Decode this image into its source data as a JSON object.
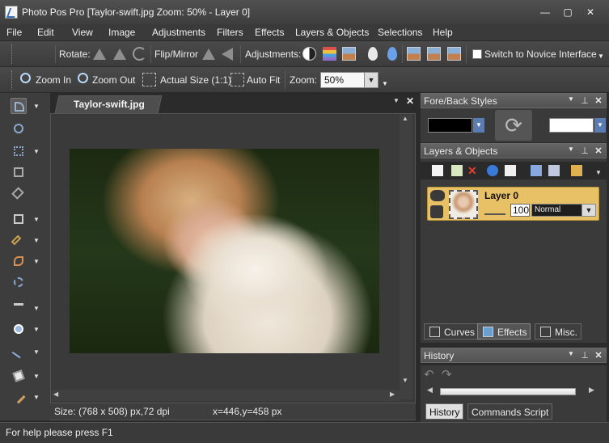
{
  "window": {
    "title": "Photo Pos Pro [Taylor-swift.jpg Zoom: 50% - Layer 0]",
    "minimize": "—",
    "restore": "▢",
    "close": "✕"
  },
  "menu": [
    "File",
    "Edit",
    "View",
    "Image",
    "Adjustments",
    "Filters",
    "Effects",
    "Layers & Objects",
    "Selections",
    "Help"
  ],
  "toolbar1": {
    "rotate_label": "Rotate:",
    "flip_label": "Flip/Mirror",
    "adjustments_label": "Adjustments:",
    "novice_label": "Switch to Novice Interface"
  },
  "toolbar2": {
    "zoom_in": "Zoom In",
    "zoom_out": "Zoom Out",
    "actual_size": "Actual Size (1:1)",
    "auto_fit": "Auto Fit",
    "zoom_label": "Zoom:",
    "zoom_value": "50%"
  },
  "document": {
    "tab_label": "Taylor-swift.jpg",
    "size_info": "Size: (768 x 508) px,72 dpi",
    "cursor_info": "x=446,y=458 px"
  },
  "panels": {
    "fore_back": "Fore/Back Styles",
    "layers": "Layers & Objects",
    "history": "History"
  },
  "layer": {
    "name": "Layer 0",
    "opacity": "100",
    "blend_mode": "Normal"
  },
  "layer_tabs": [
    "Curves",
    "Effects",
    "Misc."
  ],
  "history_tabs": [
    "History",
    "Commands Script"
  ],
  "status": "For help please press F1",
  "colors": {
    "foreground": "#000000",
    "background": "#ffffff",
    "layer_highlight": "#e8c066"
  },
  "icons": {
    "toolbox": [
      "select-arrow-icon",
      "magnifier-icon",
      "move-icon",
      "crop-icon",
      "straighten-icon",
      "marquee-icon",
      "magic-wand-icon",
      "pen-icon",
      "lasso-icon",
      "text-icon",
      "shape-icon",
      "line-icon",
      "fill-bucket-icon",
      "brush-icon"
    ]
  }
}
